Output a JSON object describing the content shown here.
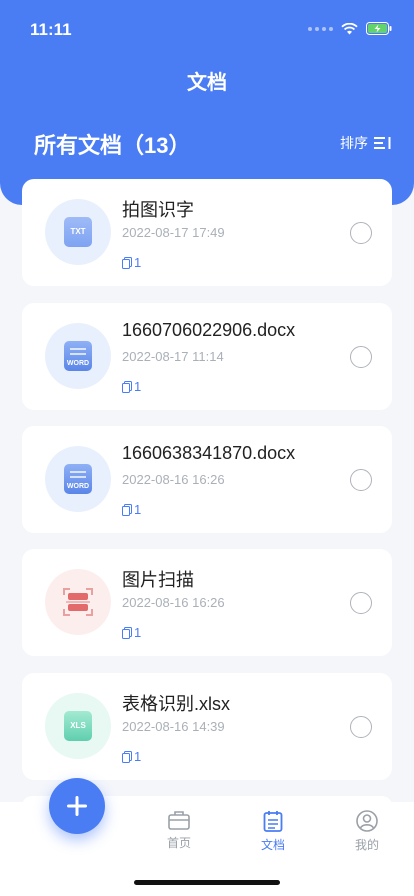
{
  "status": {
    "time": "11:11"
  },
  "header": {
    "title": "文档",
    "all_label": "所有文档（13）",
    "sort_label": "排序"
  },
  "colors": {
    "primary": "#4a7cf4",
    "word_blue": "#5b86e8",
    "scan_red": "#e26a6a",
    "xls_green": "#5fcfae"
  },
  "documents": [
    {
      "name": "拍图识字",
      "date": "2022-08-17 17:49",
      "count": "1",
      "type": "TXT",
      "icon": "txt-file-icon"
    },
    {
      "name": "1660706022906.docx",
      "date": "2022-08-17 11:14",
      "count": "1",
      "type": "WORD",
      "icon": "word-file-icon"
    },
    {
      "name": "1660638341870.docx",
      "date": "2022-08-16 16:26",
      "count": "1",
      "type": "WORD",
      "icon": "word-file-icon"
    },
    {
      "name": "图片扫描",
      "date": "2022-08-16 16:26",
      "count": "1",
      "type": "",
      "icon": "scan-icon"
    },
    {
      "name": "表格识别.xlsx",
      "date": "2022-08-16 14:39",
      "count": "1",
      "type": "XLS",
      "icon": "xls-file-icon"
    }
  ],
  "tabs": [
    {
      "label": "首页",
      "icon": "briefcase-icon",
      "active": false
    },
    {
      "label": "文档",
      "icon": "calendar-doc-icon",
      "active": true
    },
    {
      "label": "我的",
      "icon": "user-icon",
      "active": false
    }
  ],
  "fab": {
    "icon": "plus-icon"
  }
}
